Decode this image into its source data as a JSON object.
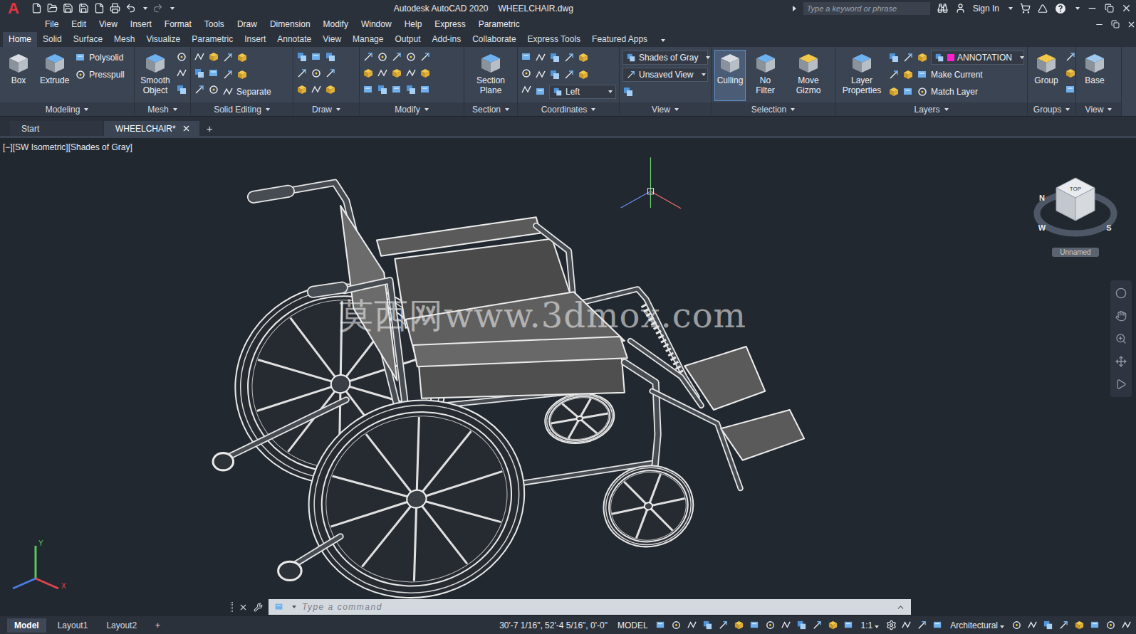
{
  "window": {
    "logo": "A",
    "title": "Autodesk AutoCAD 2020",
    "file": "WHEELCHAIR.dwg"
  },
  "search": {
    "placeholder": "Type a keyword or phrase"
  },
  "account": {
    "label": "Sign In"
  },
  "menu": [
    "File",
    "Edit",
    "View",
    "Insert",
    "Format",
    "Tools",
    "Draw",
    "Dimension",
    "Modify",
    "Window",
    "Help",
    "Express",
    "Parametric"
  ],
  "ribbon_tabs": [
    {
      "label": "Home",
      "selected": true
    },
    {
      "label": "Solid",
      "selected": false
    },
    {
      "label": "Surface",
      "selected": false
    },
    {
      "label": "Mesh",
      "selected": false
    },
    {
      "label": "Visualize",
      "selected": false
    },
    {
      "label": "Parametric",
      "selected": false
    },
    {
      "label": "Insert",
      "selected": false
    },
    {
      "label": "Annotate",
      "selected": false
    },
    {
      "label": "View",
      "selected": false
    },
    {
      "label": "Manage",
      "selected": false
    },
    {
      "label": "Output",
      "selected": false
    },
    {
      "label": "Add-ins",
      "selected": false
    },
    {
      "label": "Collaborate",
      "selected": false
    },
    {
      "label": "Express Tools",
      "selected": false
    },
    {
      "label": "Featured Apps",
      "selected": false
    }
  ],
  "ribbon_panels": [
    {
      "title": "Modeling",
      "items": [
        {
          "label": "Box",
          "kind": "large",
          "active": false
        },
        {
          "label": "Extrude",
          "kind": "large",
          "active": false
        },
        {
          "label": "Polysolid",
          "kind": "small",
          "active": false
        },
        {
          "label": "Presspull",
          "kind": "small",
          "active": false
        }
      ]
    },
    {
      "title": "Mesh",
      "items": [
        {
          "label": "Smooth Object",
          "kind": "large",
          "active": false
        }
      ]
    },
    {
      "title": "Solid Editing",
      "items": [
        {
          "label": "Separate",
          "kind": "small",
          "active": false
        }
      ]
    },
    {
      "title": "Draw",
      "items": []
    },
    {
      "title": "Modify",
      "items": []
    },
    {
      "title": "Section",
      "items": [
        {
          "label": "Section Plane",
          "kind": "large",
          "active": false
        }
      ]
    },
    {
      "title": "Coordinates",
      "items": [
        {
          "label": "Left",
          "kind": "dropdown",
          "active": false
        }
      ]
    },
    {
      "title": "View",
      "items": [
        {
          "label": "Shades of Gray",
          "kind": "dropdown",
          "active": false
        },
        {
          "label": "Unsaved View",
          "kind": "dropdown",
          "active": false
        }
      ]
    },
    {
      "title": "Selection",
      "items": [
        {
          "label": "Culling",
          "kind": "large",
          "active": true
        },
        {
          "label": "No Filter",
          "kind": "large",
          "active": false
        },
        {
          "label": "Move Gizmo",
          "kind": "large",
          "active": false
        }
      ]
    },
    {
      "title": "Layers",
      "items": [
        {
          "label": "Layer Properties",
          "kind": "large",
          "active": false
        },
        {
          "label": "ANNOTATION",
          "kind": "dropdown",
          "active": false,
          "color": "#ff1fd2"
        },
        {
          "label": "Make Current",
          "kind": "small",
          "active": false
        },
        {
          "label": "Match Layer",
          "kind": "small",
          "active": false
        }
      ]
    },
    {
      "title": "Groups",
      "items": [
        {
          "label": "Group",
          "kind": "large",
          "active": false
        }
      ]
    },
    {
      "title": "View",
      "items": [
        {
          "label": "Base",
          "kind": "large",
          "active": false
        }
      ]
    }
  ],
  "file_tabs": [
    {
      "label": "Start",
      "selected": false,
      "closable": false
    },
    {
      "label": "WHEELCHAIR*",
      "selected": true,
      "closable": true
    }
  ],
  "new_tab": "+",
  "viewport": {
    "label": "[−][SW Isometric][Shades of Gray]",
    "watermark": "莫西网www.3dmox.com"
  },
  "viewcube": {
    "face": "TOP",
    "compass": [
      "N",
      "W",
      "S"
    ],
    "view_name": "Unnamed"
  },
  "ucs": {
    "x": "X",
    "y": "Y"
  },
  "command": {
    "placeholder": "Type a command"
  },
  "layout_tabs": [
    {
      "label": "Model",
      "selected": true
    },
    {
      "label": "Layout1",
      "selected": false
    },
    {
      "label": "Layout2",
      "selected": false
    }
  ],
  "new_layout": "+",
  "status": {
    "coords": "30'-7 1/16\", 52'-4 5/16\", 0'-0\"",
    "space": "MODEL",
    "scale": "1:1",
    "units": "Architectural"
  }
}
